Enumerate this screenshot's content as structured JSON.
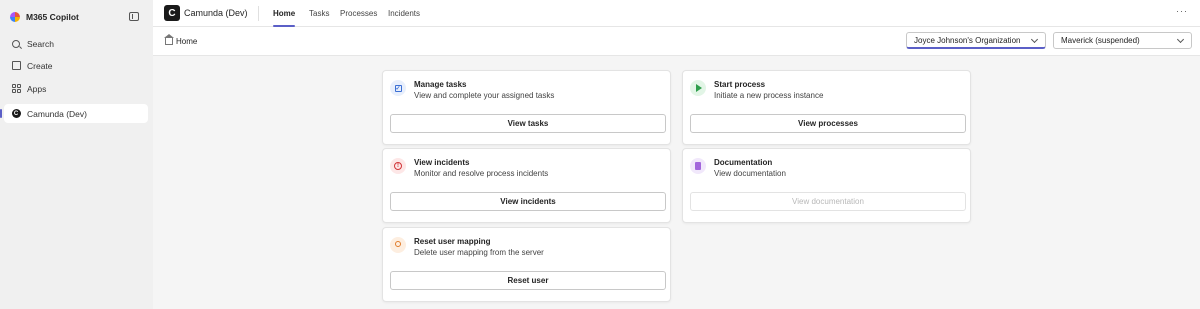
{
  "rail": {
    "title": "M365 Copilot",
    "items": [
      {
        "label": "Search",
        "icon": "search-icon"
      },
      {
        "label": "Create",
        "icon": "create-icon"
      },
      {
        "label": "Apps",
        "icon": "apps-icon"
      },
      {
        "label": "Camunda (Dev)",
        "icon": "camunda-icon",
        "active": true
      }
    ]
  },
  "header": {
    "app_logo_letter": "C",
    "app_name": "Camunda (Dev)",
    "tabs": [
      {
        "label": "Home",
        "active": true
      },
      {
        "label": "Tasks"
      },
      {
        "label": "Processes"
      },
      {
        "label": "Incidents"
      }
    ],
    "more": "···"
  },
  "breadcrumb": {
    "label": "Home"
  },
  "selectors": {
    "organization": "Joyce Johnson's Organization",
    "workspace": "Maverick (suspended)"
  },
  "cards": [
    {
      "title": "Manage tasks",
      "desc": "View and complete your assigned tasks",
      "button": "View tasks",
      "enabled": true
    },
    {
      "title": "Start process",
      "desc": "Initiate a new process instance",
      "button": "View processes",
      "enabled": true
    },
    {
      "title": "View incidents",
      "desc": "Monitor and resolve process incidents",
      "button": "View incidents",
      "enabled": true
    },
    {
      "title": "Documentation",
      "desc": "View documentation",
      "button": "View documentation",
      "enabled": false
    },
    {
      "title": "Reset user mapping",
      "desc": "Delete user mapping from the server",
      "button": "Reset user",
      "enabled": true
    }
  ],
  "colors": {
    "accent": "#5b5fc7",
    "tasks": "#3b6fd4",
    "process": "#2e9e4b",
    "incident": "#d13438",
    "doc": "#a367dc",
    "user": "#e07b2a"
  }
}
